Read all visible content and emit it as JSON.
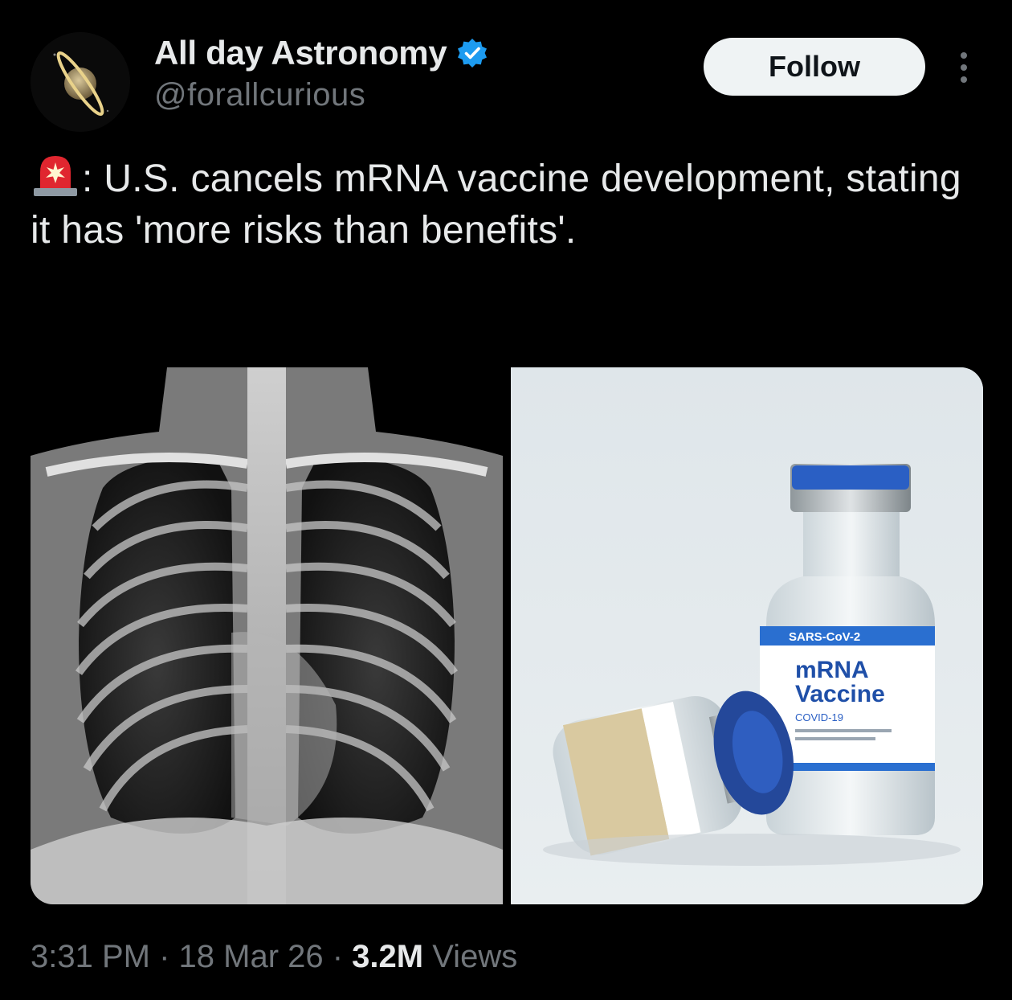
{
  "author": {
    "display_name": "All day Astronomy",
    "handle": "@forallcurious",
    "verified": true,
    "avatar_icon": "saturn-icon"
  },
  "actions": {
    "follow_label": "Follow",
    "more_icon": "more-dots-icon"
  },
  "tweet": {
    "emoji_icon": "police-siren-icon",
    "text": ": U.S. cancels mRNA vaccine development, stating it has 'more risks than benefits'."
  },
  "media": {
    "left_image": "chest-xray",
    "right_image": {
      "vial_label_top": "SARS-CoV-2",
      "vial_label_line1": "mRNA",
      "vial_label_line2": "Vaccine",
      "vial_label_sub": "COVID-19"
    }
  },
  "meta": {
    "time": "3:31 PM",
    "separator": " · ",
    "date": "18 Mar 26",
    "views_count": "3.2M",
    "views_label": " Views"
  },
  "colors": {
    "background": "#000000",
    "text_primary": "#e7e9ea",
    "text_secondary": "#71767b",
    "verified_blue": "#1d9bf0",
    "follow_bg": "#eff3f4",
    "vial_blue": "#2a5fc4"
  }
}
